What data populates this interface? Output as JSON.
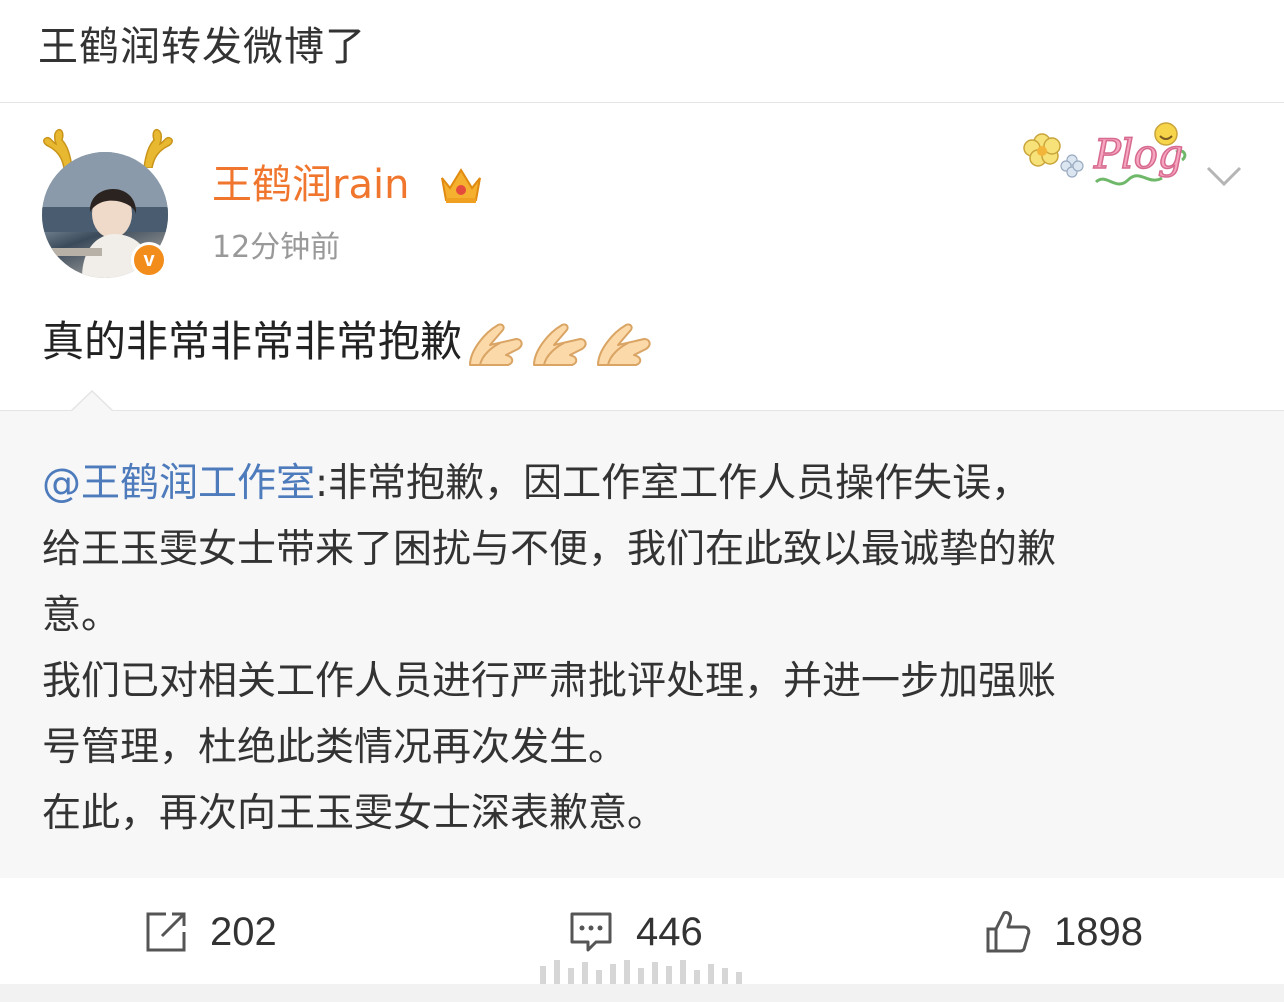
{
  "header": {
    "title": "王鹤润转发微博了"
  },
  "post": {
    "username": "王鹤润rain",
    "time": "12分钟前",
    "verify_badge": "v",
    "text": "真的非常非常非常抱歉",
    "emoji_count": 3,
    "emoji_name": "folded-hands-emoji",
    "sticker": "Plog"
  },
  "retweet": {
    "mention": "@王鹤润工作室",
    "lines": [
      ":非常抱歉，因工作室工作人员操作失误，",
      "给王玉雯女士带来了困扰与不便，我们在此致以最诚挚的歉",
      "意。",
      "我们已对相关工作人员进行严肃批评处理，并进一步加强账",
      "号管理，杜绝此类情况再次发生。",
      "在此，再次向王玉雯女士深表歉意。"
    ]
  },
  "actions": {
    "repost_count": "202",
    "comment_count": "446",
    "like_count": "1898"
  },
  "colors": {
    "username": "#f0762e",
    "mention": "#4d7bbb",
    "verify": "#f28c1b",
    "retweet_bg": "#f7f7f7"
  }
}
